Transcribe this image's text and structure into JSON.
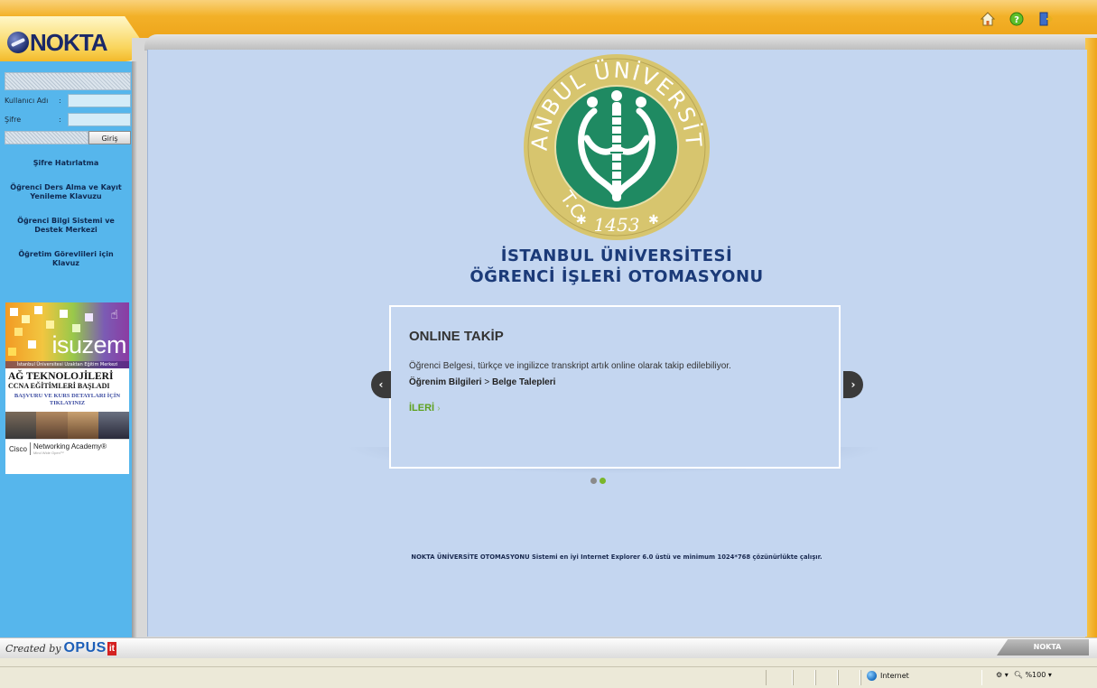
{
  "header": {
    "logo_text": "NOKTA",
    "icons": [
      "home-icon",
      "help-icon",
      "exit-icon"
    ]
  },
  "login": {
    "username_label": "Kullanıcı Adı",
    "password_label": "Şifre",
    "colon": ":",
    "username_value": "",
    "password_value": "",
    "login_button": "Giriş"
  },
  "sidebar": {
    "links": [
      "Şifre Hatırlatma",
      "Öğrenci Ders Alma ve Kayıt Yenileme Klavuzu",
      "Öğrenci Bilgi Sistemi ve Destek Merkezi",
      "Öğretim Görevlileri için Klavuz"
    ],
    "banner": {
      "brand": "isuzem",
      "brand_sub": "İstanbul Üniversitesi Uzaktan Eğitim Merkezi",
      "title": "AĞ TEKNOLOJİLERİ",
      "subtitle": "CCNA EĞİTİMLERİ BAŞLADI",
      "link": "BAŞVURU VE KURS DETAYLARI İÇİN TIKLAYINIZ",
      "cisco": "Cisco",
      "networking": "Networking Academy®",
      "tagline": "Mind Wide Open™"
    }
  },
  "main": {
    "seal": {
      "top_text": "İSTANBUL ÜNİVERSİTESİ",
      "left_text": "T.C.",
      "year": "1453"
    },
    "title_line1": "İSTANBUL ÜNİVERSİTESİ",
    "title_line2": "ÖĞRENCİ İŞLERİ OTOMASYONU",
    "slide": {
      "title": "ONLINE TAKİP",
      "text": "Öğrenci Belgesi, türkçe ve ingilizce transkript artık online olarak takip edilebiliyor.",
      "path_a": "Öğrenim Bilgileri",
      "path_sep": ">",
      "path_b": "Belge Talepleri",
      "more": "İLERİ",
      "more_arrow": "›"
    },
    "slider_dots": 2,
    "active_dot": 1,
    "footer_note": "NOKTA ÜNİVERSİTE OTOMASYONU Sistemi en iyi Internet Explorer 6.0 üstü ve minimum 1024*768 çözünürlükte çalışır."
  },
  "bottom": {
    "created_by": "Created by",
    "opus": "OPUS",
    "opus_it": "it",
    "tab": "NOKTA"
  },
  "statusbar": {
    "zone": "Internet",
    "zoom": "%100"
  },
  "colors": {
    "top_bar": "#eea51a",
    "sidebar": "#56b6ec",
    "content_bg": "#c4d6f0",
    "seal_green": "#1f8a62",
    "seal_ring": "#d7c56e",
    "title": "#1b3a78",
    "more_link": "#5ea11e"
  }
}
